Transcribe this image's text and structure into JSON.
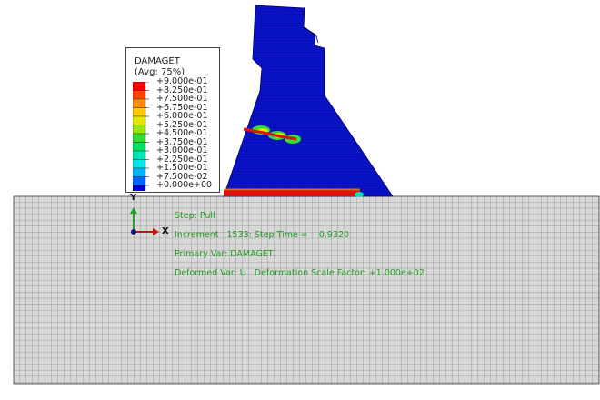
{
  "legend": {
    "title": "DAMAGET",
    "avg": "(Avg: 75%)",
    "entries": [
      {
        "label": "+9.000e-01",
        "color": "#ff0000"
      },
      {
        "label": "+8.250e-01",
        "color": "#ff4500"
      },
      {
        "label": "+7.500e-01",
        "color": "#ff8c00"
      },
      {
        "label": "+6.750e-01",
        "color": "#ffc800"
      },
      {
        "label": "+6.000e-01",
        "color": "#e6e600"
      },
      {
        "label": "+5.250e-01",
        "color": "#9be600"
      },
      {
        "label": "+4.500e-01",
        "color": "#32dc32"
      },
      {
        "label": "+3.750e-01",
        "color": "#00e664"
      },
      {
        "label": "+3.000e-01",
        "color": "#00e6b4"
      },
      {
        "label": "+2.250e-01",
        "color": "#00e6e6"
      },
      {
        "label": "+1.500e-01",
        "color": "#00b4ff"
      },
      {
        "label": "+7.500e-02",
        "color": "#0064ff"
      },
      {
        "label": "+0.000e+00",
        "color": "#0000d0"
      }
    ],
    "last_label": ""
  },
  "info": {
    "step": "Step: Pull",
    "increment": "Increment   1533: Step Time =    0.9320",
    "primary_var": "Primary Var: DAMAGET",
    "deformed_var": "Deformed Var: U   Deformation Scale Factor: +1.000e+02"
  },
  "triad": {
    "y_label": "Y",
    "x_label": "X"
  },
  "colors": {
    "mesh_fill": "#d8d8d8",
    "mesh_line": "#555555",
    "dam_fill": "#0a14c8",
    "dam_mesh": "#00008a",
    "damage_red": "#e01010",
    "info_text": "#1f9e1f"
  }
}
